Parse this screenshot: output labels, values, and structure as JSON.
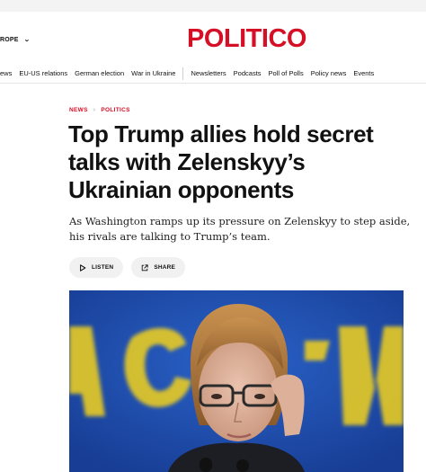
{
  "header": {
    "region_label": "ROPE",
    "logo": "POLITICO"
  },
  "nav": {
    "items": [
      "ews",
      "EU-US relations",
      "German election",
      "War in Ukraine"
    ],
    "secondary": [
      "Newsletters",
      "Podcasts",
      "Poll of Polls",
      "Policy news",
      "Events"
    ]
  },
  "article": {
    "breadcrumb": [
      "NEWS",
      "POLITICS"
    ],
    "headline": "Top Trump allies hold secret talks with Zelenskyy’s Ukrainian opponents",
    "dek": "As Washington ramps up its pressure on Zelenskyy to step aside, his rivals are talking to Trump’s team.",
    "actions": {
      "listen": "LISTEN",
      "share": "SHARE"
    }
  },
  "colors": {
    "brand_red": "#d50f25",
    "hero_blue": "#1f4fb0",
    "hero_yellow": "#f3d21c"
  }
}
